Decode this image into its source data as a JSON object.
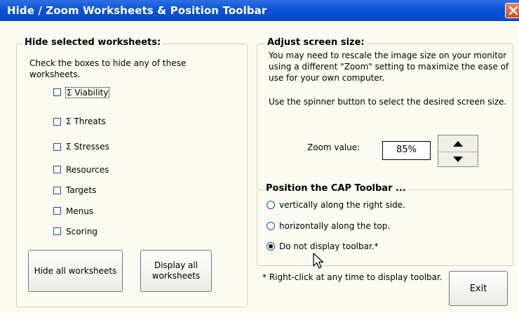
{
  "window": {
    "title": "Hide / Zoom Worksheets & Position Toolbar"
  },
  "hide_group": {
    "legend": "Hide selected worksheets:",
    "instructions": "Check the boxes to hide any of these worksheets.",
    "checkboxes": [
      {
        "label": "Σ Viability",
        "checked": false
      },
      {
        "label": "Σ Threats",
        "checked": false
      },
      {
        "label": "Σ Stresses",
        "checked": false
      },
      {
        "label": "Resources",
        "checked": false
      },
      {
        "label": "Targets",
        "checked": false
      },
      {
        "label": "Menus",
        "checked": false
      },
      {
        "label": "Scoring",
        "checked": false
      }
    ],
    "hide_all_label": "Hide all worksheets",
    "display_all_label": "Display all worksheets"
  },
  "zoom_group": {
    "legend": "Adjust screen size:",
    "description": "You may need to rescale the image size on your monitor using a different \"Zoom\" setting to maximize the ease of use for your own computer.",
    "spinner_hint": "Use the spinner button to select the desired screen size.",
    "zoom_label": "Zoom value:",
    "zoom_value": "85%"
  },
  "toolbar_group": {
    "legend": "Position the CAP Toolbar ...",
    "options": [
      {
        "label": "vertically along the right side.",
        "selected": false
      },
      {
        "label": "horizontally along the top.",
        "selected": false
      },
      {
        "label": "Do not display toolbar.*",
        "selected": true
      }
    ],
    "footnote": "* Right-click at any time to display toolbar."
  },
  "exit_label": "Exit",
  "colors": {
    "titlebar": "#0a53d8",
    "dialog_bg": "#fcfbf1",
    "group_border": "#d0d0bf"
  }
}
